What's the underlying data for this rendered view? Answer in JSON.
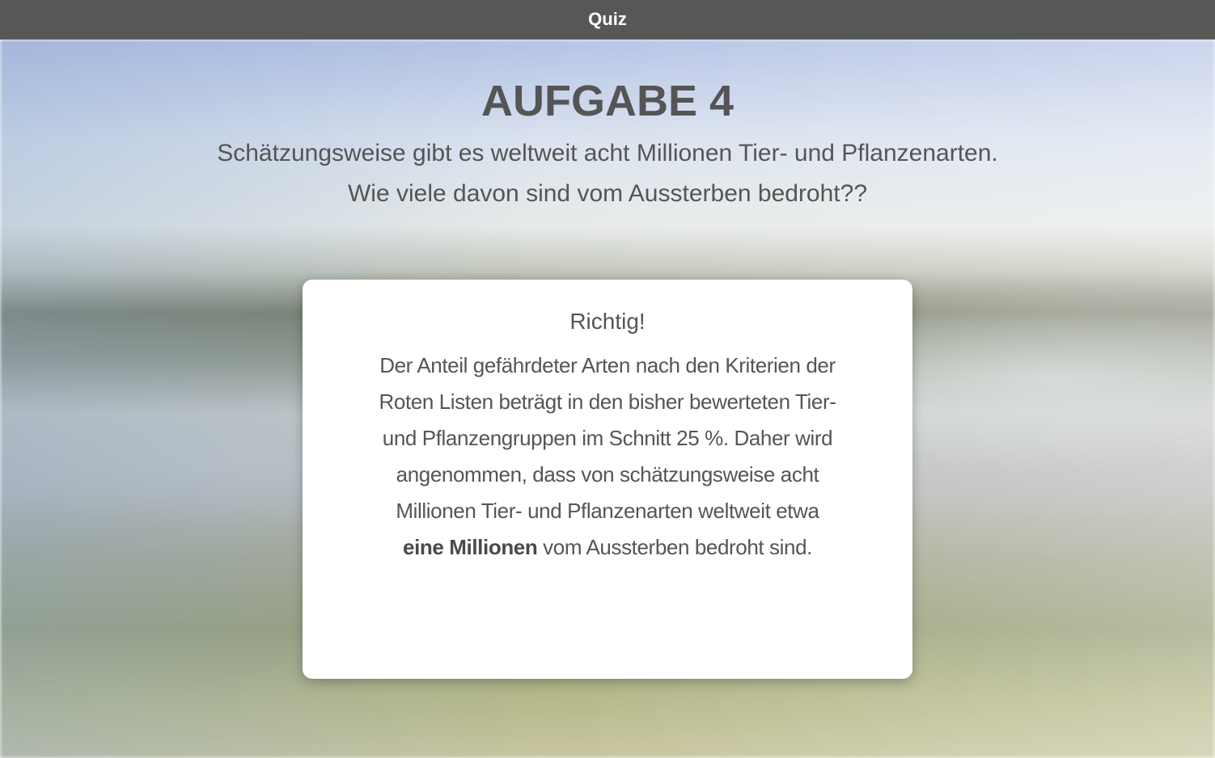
{
  "app": {
    "title": "Quiz"
  },
  "task": {
    "heading": "AUFGABE 4",
    "question_lines": [
      "Schätzungsweise gibt es weltweit acht Millionen Tier- und Pflanzenarten.",
      "Wie viele davon sind vom Aussterben bedroht??"
    ]
  },
  "feedback": {
    "result": "Richtig!",
    "explanation_lines": [
      "Der Anteil gefährdeter Arten nach den Kriterien der",
      "Roten Listen beträgt in den bisher bewerteten Tier-",
      "und Pflanzengruppen im Schnitt 25 %. Daher wird",
      "angenommen, dass von schätzungsweise acht",
      "Millionen Tier- und Pflanzenarten weltweit etwa"
    ],
    "final_bold": "eine Millionen",
    "final_rest": " vom Aussterben bedroht sind."
  }
}
